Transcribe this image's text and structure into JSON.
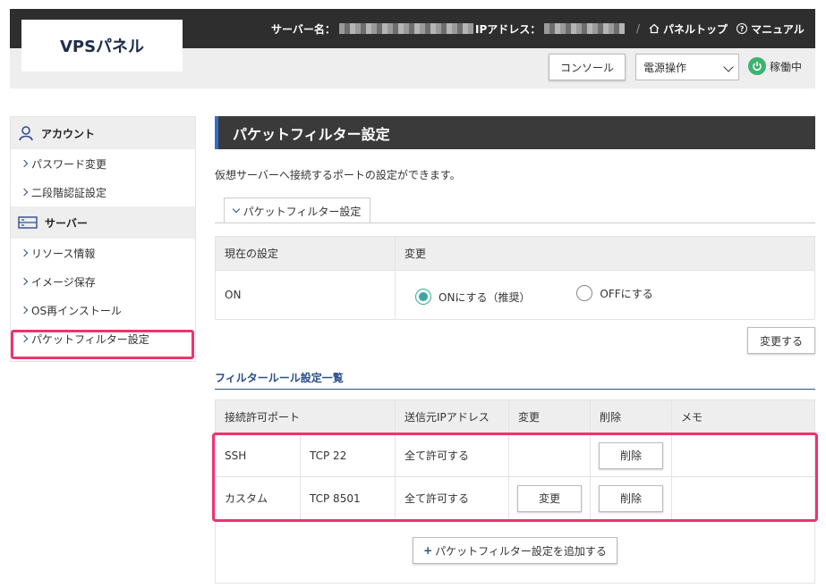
{
  "header": {
    "logo": "VPSパネル",
    "server_name_label": "サーバー名：",
    "ip_label": "IPアドレス：",
    "panel_top": "パネルトップ",
    "manual": "マニュアル",
    "console_button": "コンソール",
    "power_select": "電源操作",
    "status": "稼働中"
  },
  "sidebar": {
    "account_section": "アカウント",
    "account_items": [
      "パスワード変更",
      "二段階認証設定"
    ],
    "server_section": "サーバー",
    "server_items": [
      "リソース情報",
      "イメージ保存",
      "OS再インストール",
      "パケットフィルター設定"
    ]
  },
  "main": {
    "title": "パケットフィルター設定",
    "description": "仮想サーバーへ接続するポートの設定ができます。",
    "tab": "パケットフィルター設定",
    "setting_table": {
      "col_current": "現在の設定",
      "col_change": "変更",
      "current_value": "ON",
      "radio_on": "ONにする（推奨）",
      "radio_off": "OFFにする"
    },
    "change_button": "変更する",
    "rules_heading": "フィルタールール設定一覧",
    "rules_table": {
      "headers": [
        "接続許可ポート",
        "送信元IPアドレス",
        "変更",
        "削除",
        "メモ"
      ],
      "rows": [
        {
          "name": "SSH",
          "port": "TCP 22",
          "source": "全て許可する",
          "change": "",
          "delete": "削除"
        },
        {
          "name": "カスタム",
          "port": "TCP 8501",
          "source": "全て許可する",
          "change": "変更",
          "delete": "削除"
        }
      ]
    },
    "add_button": "パケットフィルター設定を追加する"
  }
}
